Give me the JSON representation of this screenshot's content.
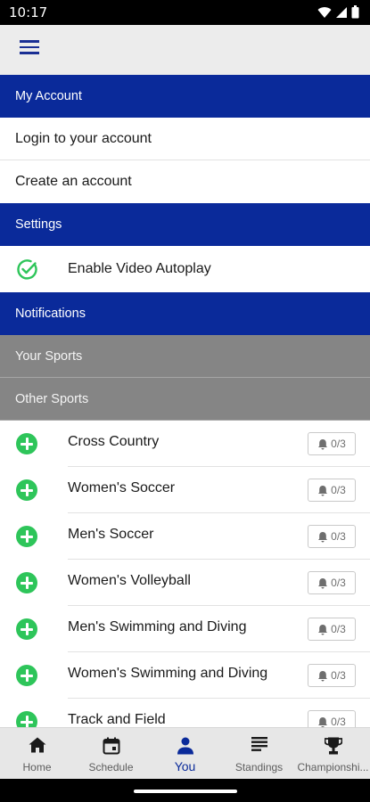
{
  "status_bar": {
    "time": "10:17"
  },
  "my_account": {
    "header": "My Account",
    "items": [
      "Login to your account",
      "Create an account"
    ]
  },
  "settings": {
    "header": "Settings",
    "autoplay_label": "Enable Video Autoplay"
  },
  "notifications": {
    "header": "Notifications",
    "your_sports_header": "Your Sports",
    "other_sports_header": "Other Sports",
    "sports": [
      {
        "name": "Cross Country",
        "count": "0/3"
      },
      {
        "name": "Women's Soccer",
        "count": "0/3"
      },
      {
        "name": "Men's Soccer",
        "count": "0/3"
      },
      {
        "name": "Women's Volleyball",
        "count": "0/3"
      },
      {
        "name": "Men's Swimming and Diving",
        "count": "0/3"
      },
      {
        "name": "Women's Swimming and Diving",
        "count": "0/3"
      },
      {
        "name": "Track and Field",
        "count": "0/3"
      }
    ]
  },
  "tabs": [
    {
      "label": "Home",
      "icon": "home-icon"
    },
    {
      "label": "Schedule",
      "icon": "calendar-icon"
    },
    {
      "label": "You",
      "icon": "person-icon",
      "active": true
    },
    {
      "label": "Standings",
      "icon": "list-icon"
    },
    {
      "label": "Championshi...",
      "icon": "trophy-icon"
    }
  ],
  "colors": {
    "primary": "#0a2a9a",
    "section_gray": "#858585",
    "accent_green": "#2ec55a"
  }
}
